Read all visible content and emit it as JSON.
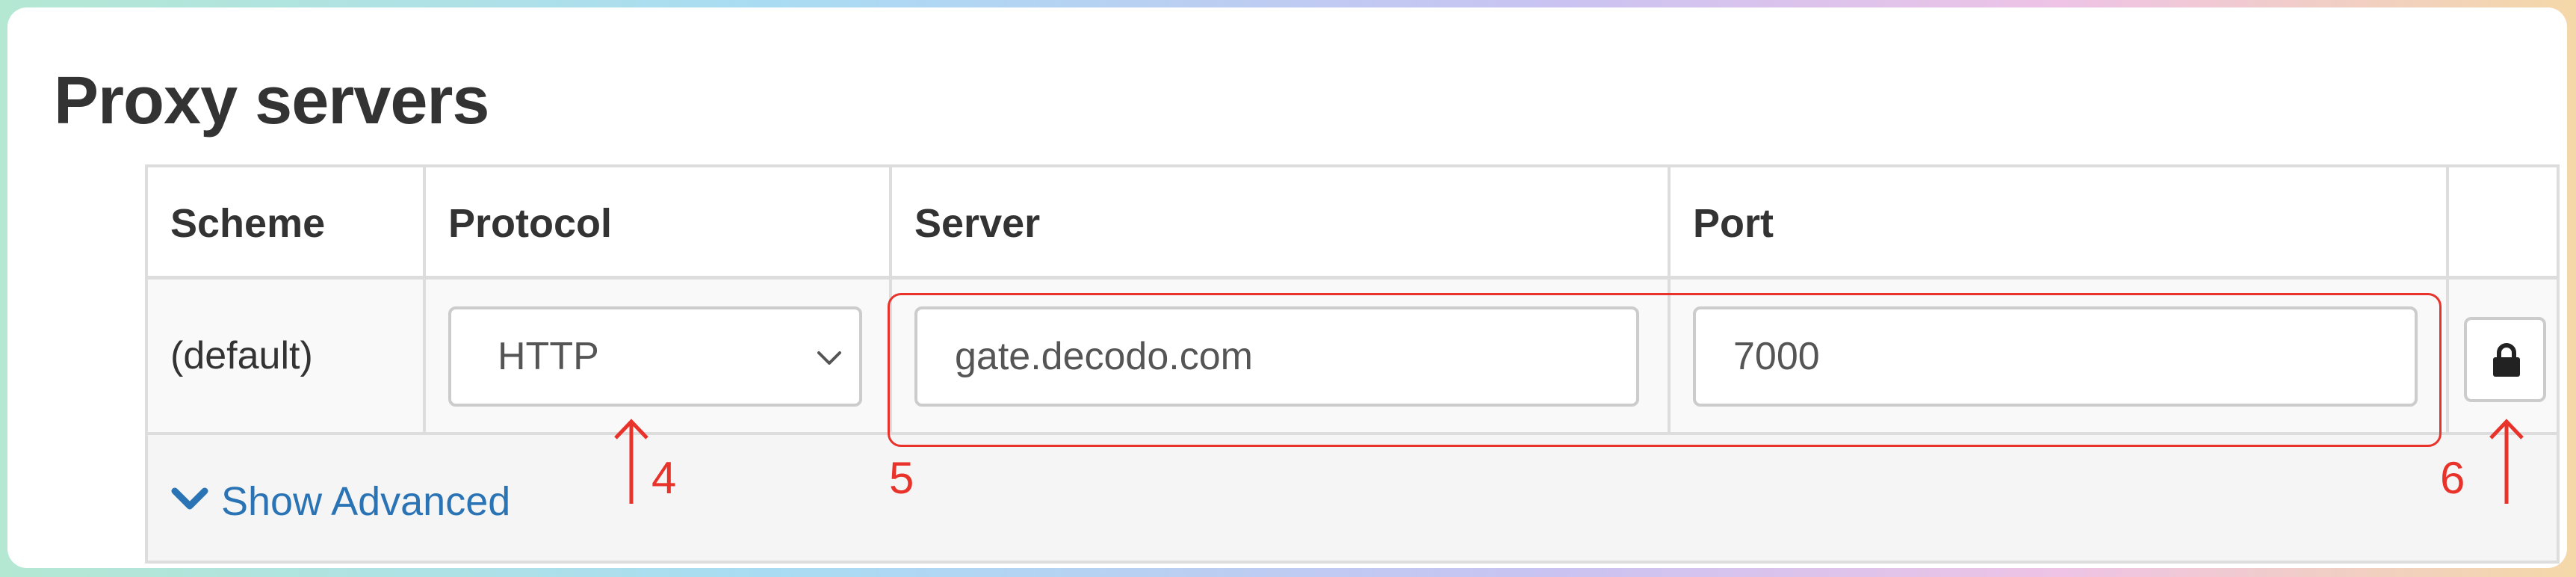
{
  "title": "Proxy servers",
  "table": {
    "headers": [
      "Scheme",
      "Protocol",
      "Server",
      "Port",
      ""
    ],
    "row": {
      "scheme": "(default)",
      "protocol": "HTTP",
      "server": "gate.decodo.com",
      "port": "7000"
    },
    "show_advanced": "Show Advanced"
  },
  "annotations": {
    "protocol_marker": "4",
    "server_port_marker": "5",
    "lock_marker": "6"
  },
  "colors": {
    "annotation": "#e8322a",
    "link": "#2a73b5"
  }
}
